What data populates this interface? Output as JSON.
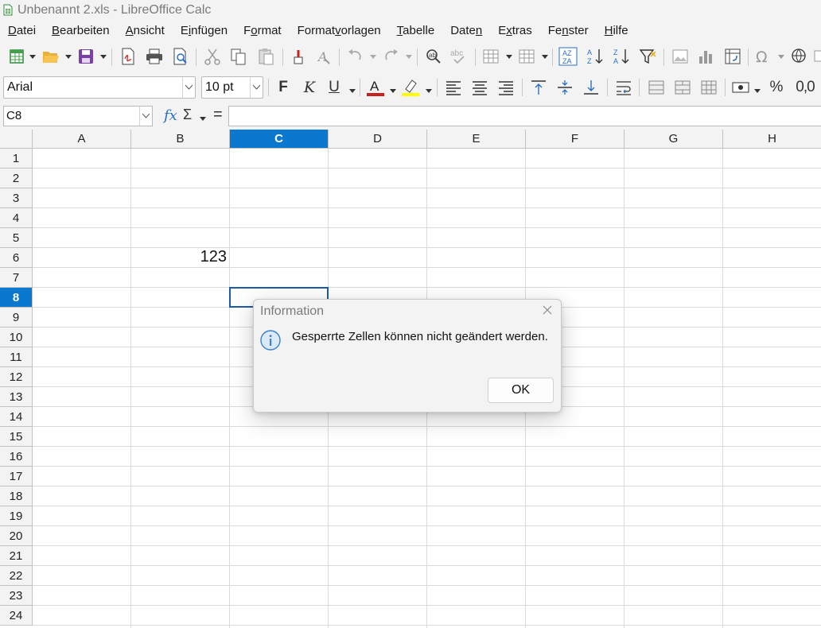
{
  "window": {
    "title": "Unbenannt 2.xls - LibreOffice Calc"
  },
  "menu": [
    {
      "pre": "",
      "ul": "D",
      "post": "atei"
    },
    {
      "pre": "",
      "ul": "B",
      "post": "earbeiten"
    },
    {
      "pre": "",
      "ul": "A",
      "post": "nsicht"
    },
    {
      "pre": "E",
      "ul": "i",
      "post": "nfügen"
    },
    {
      "pre": "F",
      "ul": "o",
      "post": "rmat"
    },
    {
      "pre": "Format",
      "ul": "v",
      "post": "orlagen"
    },
    {
      "pre": "",
      "ul": "T",
      "post": "abelle"
    },
    {
      "pre": "Date",
      "ul": "n",
      "post": ""
    },
    {
      "pre": "E",
      "ul": "x",
      "post": "tras"
    },
    {
      "pre": "Fe",
      "ul": "n",
      "post": "ster"
    },
    {
      "pre": "",
      "ul": "H",
      "post": "ilfe"
    }
  ],
  "format_toolbar": {
    "font_name": "Arial",
    "font_size": "10 pt",
    "bold_label": "F",
    "italic_label": "K",
    "underline_label": "U",
    "percent_label": "%",
    "decimal_label": "0,0"
  },
  "formula_bar": {
    "cell_reference": "C8",
    "fx_label": "fx",
    "sigma_label": "Σ",
    "equals_label": "=",
    "content": ""
  },
  "sheet": {
    "columns": [
      "A",
      "B",
      "C",
      "D",
      "E",
      "F",
      "G",
      "H"
    ],
    "rows": [
      "1",
      "2",
      "3",
      "4",
      "5",
      "6",
      "7",
      "8",
      "9",
      "10",
      "11",
      "12",
      "13",
      "14",
      "15",
      "16",
      "17",
      "18",
      "19",
      "20",
      "21",
      "22",
      "23",
      "24"
    ],
    "active_column": "C",
    "active_row": "8",
    "cells": {
      "B6": "123"
    }
  },
  "dialog": {
    "title": "Information",
    "message": "Gesperrte Zellen können nicht geändert werden.",
    "ok_label": "OK",
    "icon": "info-icon"
  },
  "colors": {
    "accent": "#0b78d0",
    "font_color_bar": "#c9211e",
    "highlight_bar": "#ffff00",
    "cell_cursor": "#1d5aa8"
  }
}
